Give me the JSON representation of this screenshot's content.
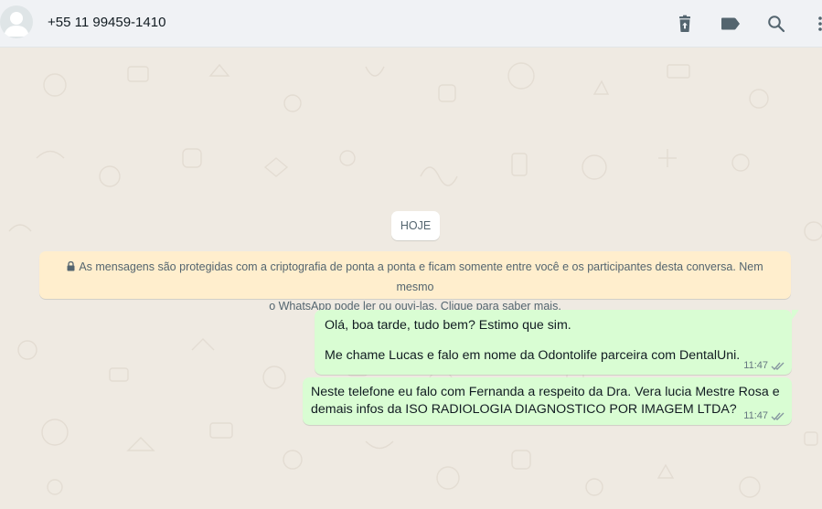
{
  "header": {
    "contact_name": "+55 11 99459-1410",
    "icons": [
      "archive-icon",
      "label-icon",
      "search-icon",
      "menu-icon"
    ]
  },
  "chat": {
    "day_chip": "HOJE",
    "encryption_notice": {
      "line1": "As mensagens são protegidas com a criptografia de ponta a ponta e ficam somente entre você e os participantes desta conversa. Nem mesmo",
      "line2": "o WhatsApp pode ler ou ouvi-las. Clique para saber mais."
    },
    "messages": [
      {
        "lines": [
          "Olá, boa tarde, tudo bem? Estimo que sim.",
          "",
          "Me chame Lucas e falo em nome da Odontolife parceira com DentalUni."
        ],
        "time": "11:47",
        "status": "read"
      },
      {
        "lines": [
          "Neste telefone eu falo com Fernanda a respeito da Dra. Vera lucia Mestre Rosa e",
          "demais infos da ISO RADIOLOGIA DIAGNOSTICO POR IMAGEM LTDA?"
        ],
        "time": "11:47",
        "status": "read"
      }
    ]
  },
  "colors": {
    "header_bg": "#f0f2f5",
    "chat_bg": "#efeae2",
    "outgoing_bubble": "#d9fdd3",
    "notice_bg": "#ffeecd",
    "icon": "#54656f",
    "read_ticks": "#8696a0"
  }
}
